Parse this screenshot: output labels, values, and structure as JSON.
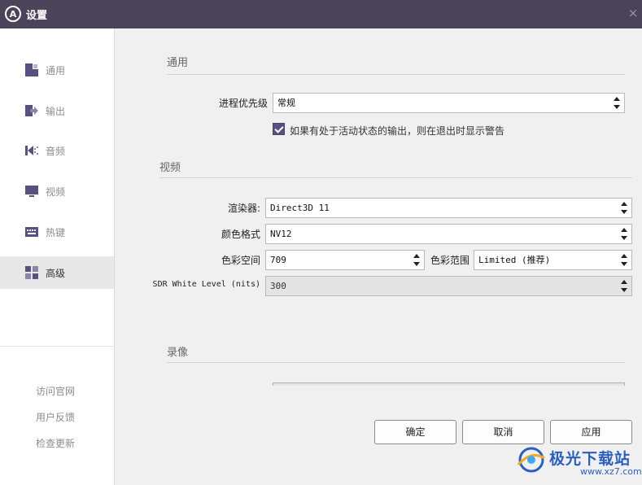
{
  "window": {
    "title": "设置",
    "close_glyph": "×",
    "logo_letter": "A"
  },
  "sidebar": {
    "items": [
      {
        "label": "通用",
        "icon": "general-icon"
      },
      {
        "label": "输出",
        "icon": "output-icon"
      },
      {
        "label": "音频",
        "icon": "audio-icon"
      },
      {
        "label": "视频",
        "icon": "video-icon"
      },
      {
        "label": "热键",
        "icon": "hotkey-icon"
      },
      {
        "label": "高级",
        "icon": "advanced-icon",
        "active": true
      }
    ],
    "links": [
      "访问官网",
      "用户反馈",
      "检查更新"
    ]
  },
  "general": {
    "title": "通用",
    "priority_label": "进程优先级",
    "priority_value": "常规",
    "confirm_checked": true,
    "confirm_text": "如果有处于活动状态的输出，则在退出时显示警告"
  },
  "video": {
    "title": "视频",
    "renderer_label": "渲染器:",
    "renderer_value": "Direct3D 11",
    "format_label": "颜色格式",
    "format_value": "NV12",
    "colorspace_label": "色彩空间",
    "colorspace_value": "709",
    "range_label": "色彩范围",
    "range_value": "Limited (推荐)",
    "sdr_label": "SDR White Level (nits)",
    "sdr_value": "300"
  },
  "recording": {
    "title": "录像"
  },
  "buttons": {
    "ok": "确定",
    "cancel": "取消",
    "apply": "应用"
  },
  "watermark": {
    "text": "极光下载站",
    "url": "www.xz7.com"
  },
  "colors": {
    "titlebar": "#4a4359",
    "accent": "#5a5080",
    "brand_watermark": "#2a5fbe"
  }
}
